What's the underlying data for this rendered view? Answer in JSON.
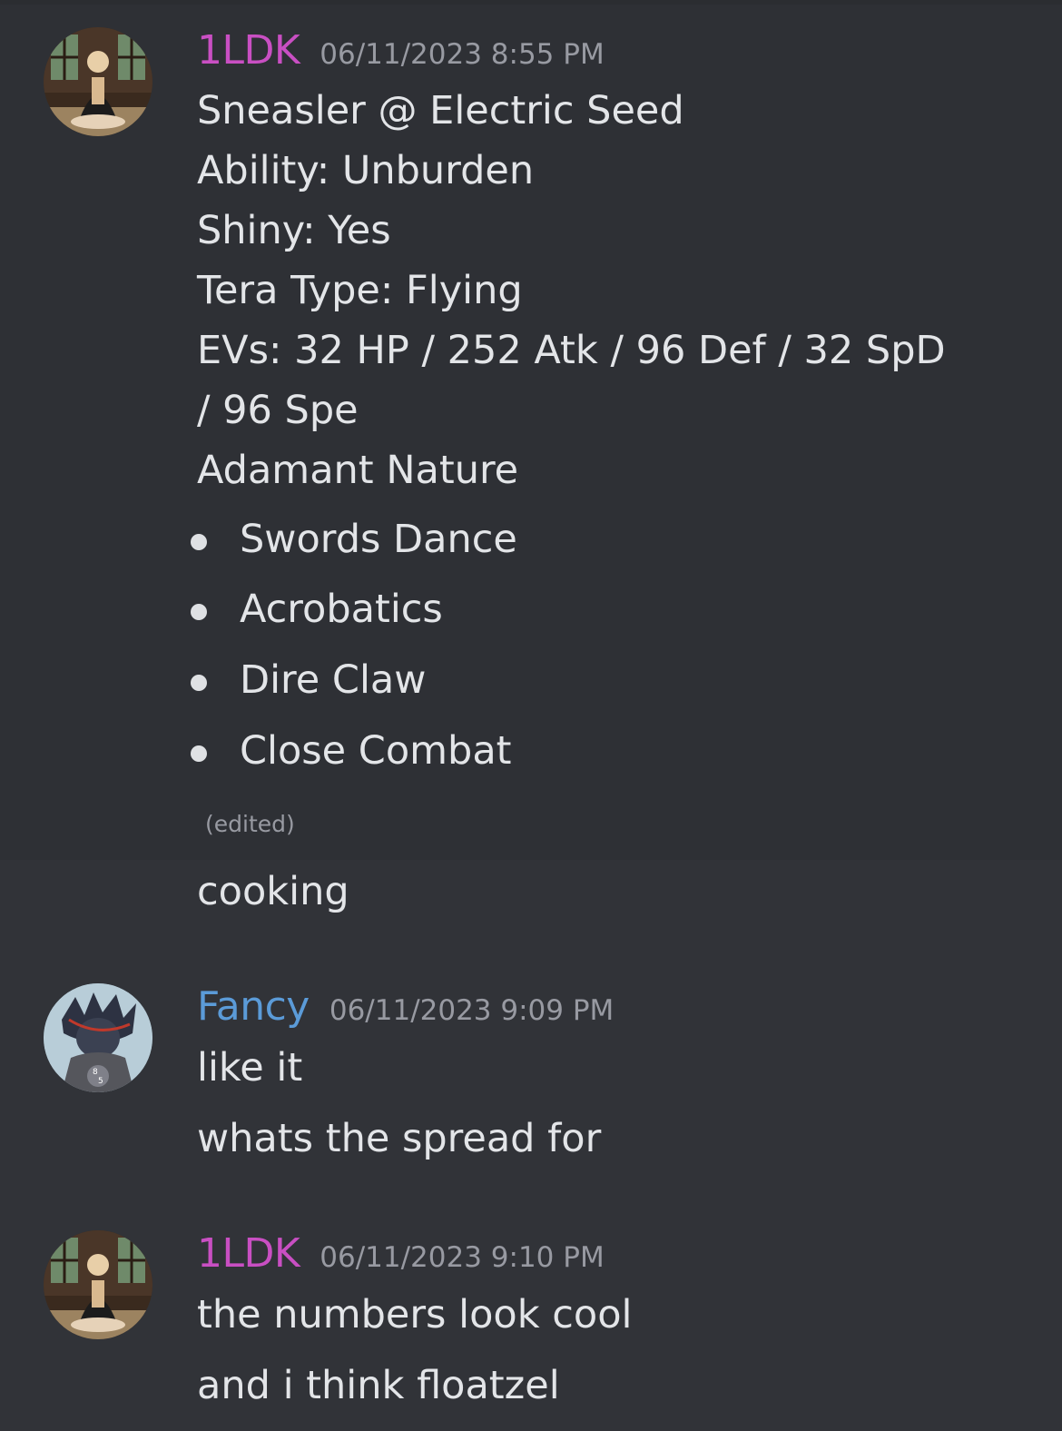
{
  "colors": {
    "user_1ldk": "#c94fc3",
    "user_fancy": "#5b9bd8"
  },
  "messages": [
    {
      "author": "1LDK",
      "timestamp": "06/11/2023 8:55 PM",
      "lines": [
        "Sneasler @ Electric Seed",
        "Ability: Unburden",
        "Shiny: Yes",
        "Tera Type: Flying",
        "EVs: 32 HP / 252 Atk / 96 Def / 32 SpD",
        "/ 96 Spe",
        "Adamant Nature"
      ],
      "moves": [
        "Swords Dance",
        "Acrobatics",
        "Dire Claw",
        "Close Combat"
      ],
      "edited_label": "(edited)",
      "followup": "cooking"
    },
    {
      "author": "Fancy",
      "timestamp": "06/11/2023 9:09 PM",
      "lines": [
        "like it",
        "whats the spread for"
      ]
    },
    {
      "author": "1LDK",
      "timestamp": "06/11/2023 9:10 PM",
      "lines": [
        "the numbers look cool",
        "and i think floatzel"
      ]
    }
  ]
}
